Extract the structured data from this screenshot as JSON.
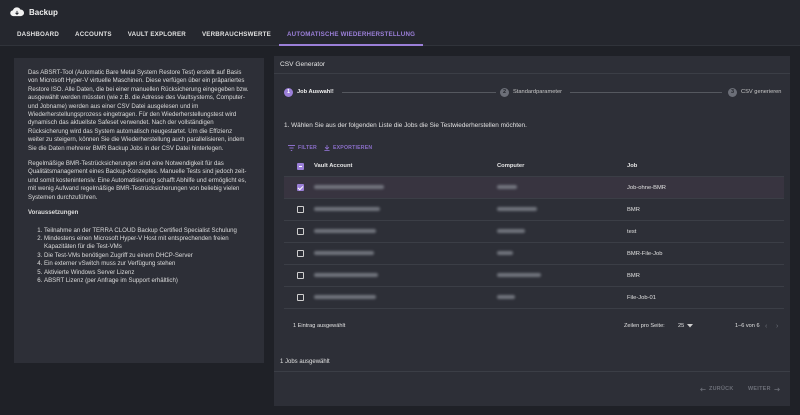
{
  "app": {
    "title": "Backup"
  },
  "tabs": [
    {
      "label": "DASHBOARD"
    },
    {
      "label": "ACCOUNTS"
    },
    {
      "label": "VAULT EXPLORER"
    },
    {
      "label": "VERBRAUCHSWERTE"
    },
    {
      "label": "AUTOMATISCHE WIEDERHERSTELLUNG"
    }
  ],
  "info": {
    "p1": "Das ABSRT-Tool (Automatic Bare Metal System Restore Test) erstellt auf Basis von Microsoft Hyper-V virtuelle Maschinen. Diese verfügen über ein präpariertes Restore ISO. Alle Daten, die bei einer manuellen Rücksicherung eingegeben bzw. ausgewählt werden müssten (wie z.B. die Adresse des Vaultsystems, Computer- und Jobname) werden aus einer CSV Datei ausgelesen und im Wiederherstellungsprozess eingetragen. Für den Wiederherstellungstest wird dynamisch das aktuellste Safeset verwendet. Nach der vollständigen Rücksicherung wird das System automatisch neugestartet. Um die Effizienz weiter zu steigern, können Sie die Wiederherstellung auch parallelisieren, indem Sie die Daten mehrerer BMR Backup Jobs in der CSV Datei hinterlegen.",
    "p2": "Regelmäßige BMR-Testrücksicherungen sind eine Notwendigkeit für das Qualitätsmanagement eines Backup-Konzeptes. Manuelle Tests sind jedoch zeit- und somit kostenintensiv. Eine Automatisierung schafft Abhilfe und ermöglicht es, mit wenig Aufwand regelmäßige BMR-Testrücksicherungen von beliebig vielen Systemen durchzuführen.",
    "req_title": "Voraussetzungen",
    "requirements": [
      "Teilnahme an der TERRA CLOUD Backup Certified Specialist Schulung",
      "Mindestens einen Microsoft Hyper-V Host mit entsprechenden freien Kapazitäten für die Test-VMs",
      "Die Test-VMs benötigen Zugriff zu einem DHCP-Server",
      "Ein externer vSwitch muss zur Verfügung stehen",
      "Aktivierte Windows Server Lizenz",
      "ABSRT Lizenz (per Anfrage im Support erhältlich)"
    ]
  },
  "generator": {
    "title": "CSV Generator",
    "steps": [
      {
        "num": "1",
        "label": "Job Auswahl!"
      },
      {
        "num": "2",
        "label": "Standardparameter"
      },
      {
        "num": "3",
        "label": "CSV generieren"
      }
    ],
    "instruction": "1. Wählen Sie aus der folgenden Liste die Jobs die Sie Testwiederherstellen möchten.",
    "toolbar": {
      "filter": "FILTER",
      "export": "EXPORTIEREN"
    },
    "columns": {
      "vault": "Vault Account",
      "computer": "Computer",
      "job": "Job"
    },
    "rows": [
      {
        "job": "Job-ohne-BMR",
        "checked": true
      },
      {
        "job": "BMR",
        "checked": false
      },
      {
        "job": "test",
        "checked": false
      },
      {
        "job": "BMR-File-Job",
        "checked": false
      },
      {
        "job": "BMR",
        "checked": false
      },
      {
        "job": "File-Job-01",
        "checked": false
      }
    ],
    "footer": {
      "selected": "1 Eintrag ausgewählt",
      "per_page_label": "Zeilen pro Seite:",
      "per_page": "25",
      "range": "1–6 von 6"
    },
    "jobs_selected": "1 Jobs ausgewählt",
    "back": "ZURÜCK",
    "next": "WEITER"
  },
  "colors": {
    "accent": "#9b7fd8",
    "background": "#1f2127",
    "panel": "#2d2f37"
  }
}
